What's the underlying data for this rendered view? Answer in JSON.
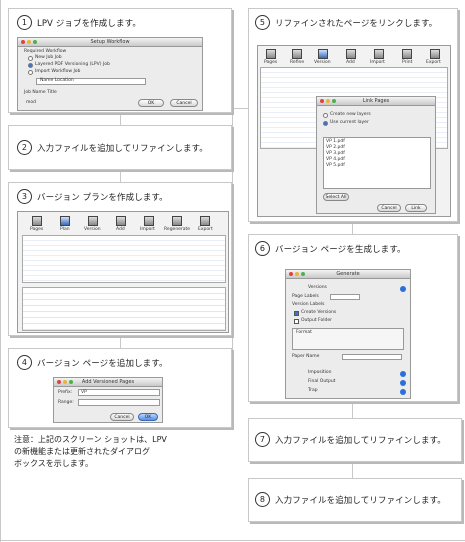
{
  "steps": [
    {
      "num": "1",
      "label": "LPV ジョブを作成します。"
    },
    {
      "num": "2",
      "label": "入力ファイルを追加してリファインします。"
    },
    {
      "num": "3",
      "label": "バージョン プランを作成します。"
    },
    {
      "num": "4",
      "label": "バージョン ページを追加します。"
    },
    {
      "num": "5",
      "label": "リファインされたページをリンクします。"
    },
    {
      "num": "6",
      "label": "バージョン ページを生成します。"
    },
    {
      "num": "7",
      "label": "入力ファイルを追加してリファインします。"
    },
    {
      "num": "8",
      "label": "入力ファイルを追加してリファインします。"
    }
  ],
  "note": {
    "line1": "注意：上記のスクリーン ショットは、LPV",
    "line2": "の新機能または更新されたダイアログ",
    "line3": "ボックスを示します。"
  },
  "shot1": {
    "title": "Setup Workflow",
    "group": "Required Workflow",
    "opt1": "New Job Job",
    "opt2": "Layered PDF Versioning (LPV) Job",
    "opt3": "Import Workflow Job",
    "field_label": "Name Location",
    "section": "Job Name Title",
    "name_value": "mod",
    "ok": "OK",
    "cancel": "Cancel"
  },
  "shot3": {
    "toolbar": [
      "Pages",
      "Plan",
      "Version",
      "Add",
      "Import",
      "Regenerate",
      "Export"
    ]
  },
  "shot4": {
    "title": "Add Versioned Pages",
    "prefix_label": "Prefix:",
    "prefix_value": "VP",
    "range_label": "Range:",
    "cancel": "Cancel",
    "ok": "OK"
  },
  "shot5": {
    "toolbar": [
      "Pages",
      "Refine",
      "Version",
      "Add",
      "Import",
      "Print",
      "Export"
    ],
    "dialog_title": "Link Pages",
    "opt1": "Create new layers",
    "opt2": "Use current layer",
    "list_items": [
      "VP 1.pdf",
      "VP 2.pdf",
      "VP 3.pdf",
      "VP 4.pdf",
      "VP 5.pdf"
    ],
    "select_all": "Select All",
    "cancel": "Cancel",
    "link": "Link"
  },
  "shot6": {
    "title": "Generate",
    "section": "Versions",
    "rows": [
      "Page Labels",
      "Version Labels",
      "Output Folder",
      "Create Versions",
      "Format",
      "Paper Name"
    ],
    "footer": [
      "Imposition",
      "Final Output",
      "Trap"
    ]
  },
  "colors": {
    "dot_red": "#e0443c",
    "dot_yellow": "#e8b53a",
    "dot_green": "#4bb34a",
    "accent_blue": "#2c6fd8"
  }
}
